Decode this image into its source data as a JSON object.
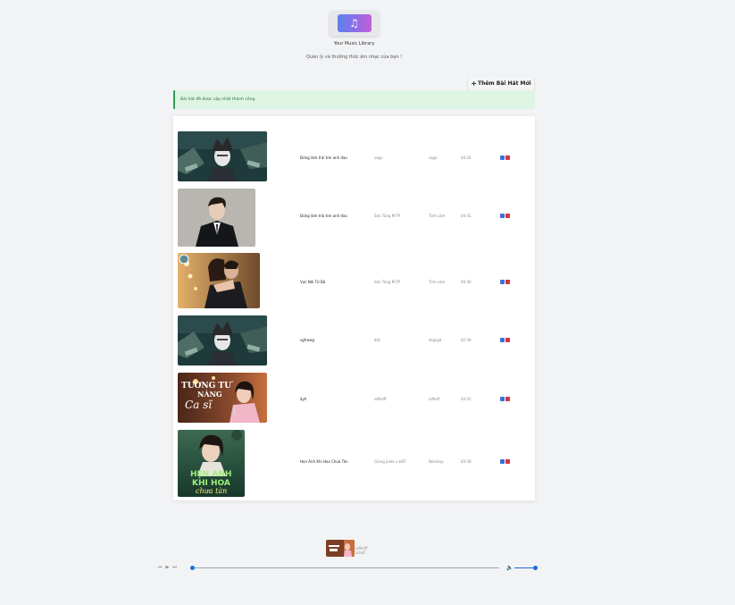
{
  "header": {
    "logo_icon": "music-note-icon",
    "title": "Your Music Library",
    "subtitle": "Quản lý và thưởng thức âm nhạc của bạn !"
  },
  "add_button": {
    "icon": "plus-icon",
    "label": "Thêm Bài Hát Mới"
  },
  "alert": {
    "message": "Bài hát đã được cập nhật thành công."
  },
  "songs": [
    {
      "title": "Đừng làm trái tim anh đau",
      "artist": "sago",
      "genre": "sago",
      "duration": "04:24"
    },
    {
      "title": "Đừng làm trái tim anh đau",
      "artist": "Sơn Tùng M-TP",
      "genre": "Tình cảm",
      "duration": "04:41"
    },
    {
      "title": "Vực Nối Từ Đó",
      "artist": "Sơn Tùng M-TP",
      "genre": "Tình cảm",
      "duration": "04:40"
    },
    {
      "title": "sgfrweg",
      "artist": "ăấs",
      "genre": "dsgsgd",
      "duration": "02:39"
    },
    {
      "title": "ậyh",
      "artist": "sđfsdff",
      "genre": "sđfsdf",
      "duration": "04:41"
    },
    {
      "title": "Hẹn Anh Khi Hoa Chưa Tàn",
      "artist": "Giang Jolee x HAT",
      "genre": "Nonstop",
      "duration": "03:39"
    }
  ],
  "thumbnail_texts": {
    "song5_line1": "TƯƠNG TƯ",
    "song5_line2": "NÀNG",
    "song5_line3": "Ca sĩ",
    "song6_line1": "HẸN ANH",
    "song6_line2": "KHI HOA",
    "song6_line3": "chưa tàn"
  },
  "player": {
    "alt_line1": "sđfsdff",
    "alt_line2": "sdsdf",
    "progress": 0.0,
    "volume": 1.0,
    "controls": [
      "previous-icon",
      "play-icon",
      "next-icon"
    ]
  },
  "colors": {
    "accent": "#1b6ee0",
    "success_bg": "#dff5e4",
    "success_border": "#2e9e55",
    "edit": "#3b6fd8",
    "delete": "#d8343a"
  }
}
